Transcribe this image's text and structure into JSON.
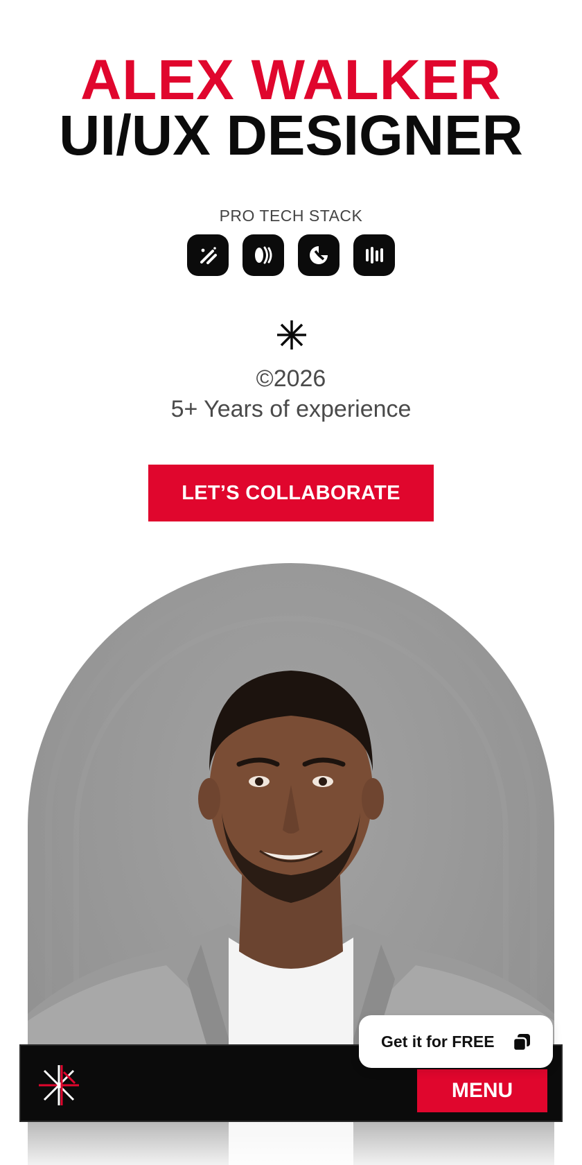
{
  "hero": {
    "name": "ALEX WALKER",
    "role": "UI/UX DESIGNER"
  },
  "stack": {
    "label": "PRO TECH STACK",
    "icons": [
      "magic-wand-icon",
      "waves-icon",
      "clock-logo-icon",
      "bars-icon"
    ]
  },
  "meta": {
    "copyright": "©2026",
    "experience": "5+ Years of experience"
  },
  "cta": {
    "label": "LET’S COLLABORATE"
  },
  "bottom_bar": {
    "menu_label": "MENU",
    "promo_label": "Get it for FREE"
  },
  "colors": {
    "accent": "#e0062d",
    "dark": "#0b0b0b",
    "text_muted": "#4a4a4a"
  }
}
